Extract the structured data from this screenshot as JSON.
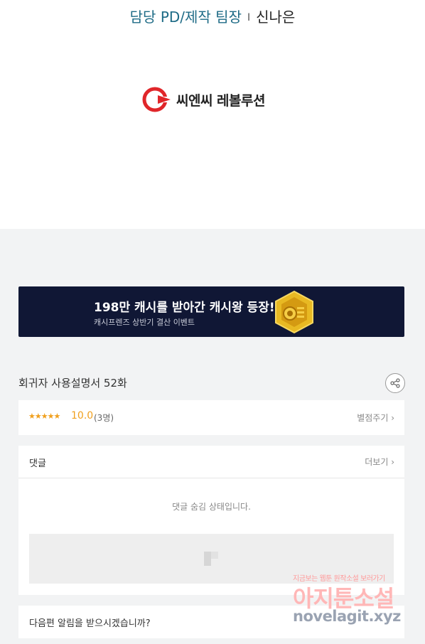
{
  "credits": {
    "role": "담당 PD/제작 팀장",
    "separator": "I",
    "name": "신나은"
  },
  "logo": {
    "text": "씨엔씨 레볼루션",
    "brand_color": "#e0262a"
  },
  "banner": {
    "title": "198만 캐시를 받아간 캐시왕 등장!",
    "subtitle": "캐시프렌즈 상반기 결산 이벤트",
    "background": "#101735"
  },
  "episode": {
    "title": "회귀자 사용설명서 52화"
  },
  "rating": {
    "stars": "★★★★★",
    "score": "10.0",
    "count": "(3명)",
    "rate_label": "별점주기 ›"
  },
  "comments": {
    "title": "댓글",
    "more_label": "더보기 ›",
    "hidden_message": "댓글 숨김 상태입니다."
  },
  "notify": {
    "question": "다음편 알림을 받으시겠습니까?"
  },
  "watermark": {
    "line1": "지금보는 웹툰 원작소설 보러가기",
    "line2": "아지툰소설",
    "line3": "novelagit.xyz"
  }
}
